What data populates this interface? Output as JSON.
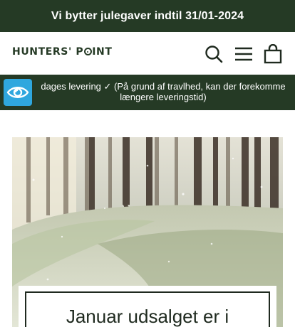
{
  "announcement": {
    "text": "Vi bytter julegaver indtil 31/01-2024"
  },
  "header": {
    "logo_part1": "HUNTERS' P",
    "logo_part2": "INT",
    "icons": [
      "search-icon",
      "hamburger-menu-icon",
      "shopping-bag-icon"
    ]
  },
  "shipping": {
    "line1": "dages levering ✓ (På grund af travlhed, kan der forekomme",
    "line2": "længere leveringstid)",
    "badge_color": "#2fa7de"
  },
  "hero": {
    "title": "Januar udsalget er i"
  },
  "colors": {
    "brand_green": "#253a25",
    "text_dark": "#1f2a1f",
    "background": "#ffffff"
  }
}
